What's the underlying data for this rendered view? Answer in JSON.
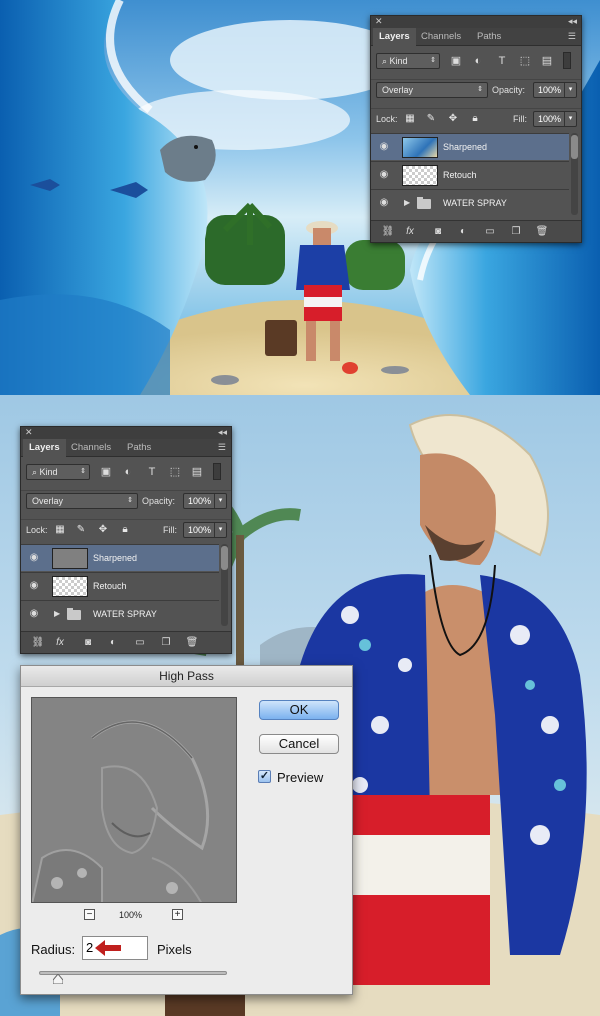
{
  "top_panel": {
    "tabs": [
      "Layers",
      "Channels",
      "Paths"
    ],
    "filter_kind": "Kind",
    "blend_mode": "Overlay",
    "opacity_label": "Opacity:",
    "opacity_value": "100%",
    "lock_label": "Lock:",
    "fill_label": "Fill:",
    "fill_value": "100%",
    "layers": [
      {
        "name": "Sharpened",
        "selected": true,
        "thumb": "photo"
      },
      {
        "name": "Retouch",
        "selected": false,
        "thumb": "transparent"
      },
      {
        "name": "WATER SPRAY",
        "selected": false,
        "thumb": "folder"
      }
    ]
  },
  "bottom_panel": {
    "tabs": [
      "Layers",
      "Channels",
      "Paths"
    ],
    "filter_kind": "Kind",
    "blend_mode": "Overlay",
    "opacity_label": "Opacity:",
    "opacity_value": "100%",
    "lock_label": "Lock:",
    "fill_label": "Fill:",
    "fill_value": "100%",
    "layers": [
      {
        "name": "Sharpened",
        "selected": true,
        "thumb": "grey"
      },
      {
        "name": "Retouch",
        "selected": false,
        "thumb": "transparent"
      },
      {
        "name": "WATER SPRAY",
        "selected": false,
        "thumb": "folder"
      }
    ]
  },
  "high_pass": {
    "title": "High Pass",
    "ok_label": "OK",
    "cancel_label": "Cancel",
    "preview_label": "Preview",
    "preview_checked": true,
    "zoom_value": "100%",
    "radius_label": "Radius:",
    "radius_value": "2",
    "unit_label": "Pixels",
    "slider_fraction": 0.1
  },
  "icons": {
    "panel_close": "close-icon",
    "panel_collapse": "double-chevron-icon",
    "panel_menu": "panel-menu-icon",
    "search": "search-icon",
    "eye": "eye-icon",
    "arrow": "red-arrow-icon"
  },
  "colors": {
    "panel_bg": "#535353",
    "selected_layer": "#5c6f8c",
    "ok_button": "#7bb1ef",
    "arrow": "#c0201e"
  }
}
